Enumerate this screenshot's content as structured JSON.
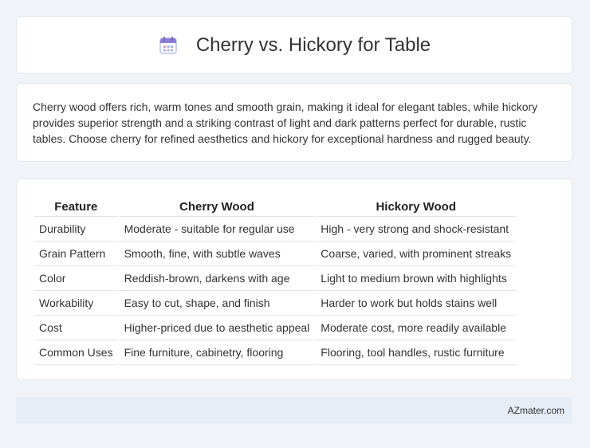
{
  "header": {
    "title": "Cherry vs. Hickory for Table",
    "icon": "calendar-icon"
  },
  "summary": {
    "text": "Cherry wood offers rich, warm tones and smooth grain, making it ideal for elegant tables, while hickory provides superior strength and a striking contrast of light and dark patterns perfect for durable, rustic tables. Choose cherry for refined aesthetics and hickory for exceptional hardness and rugged beauty."
  },
  "table": {
    "headers": [
      "Feature",
      "Cherry Wood",
      "Hickory Wood"
    ],
    "rows": [
      [
        "Durability",
        "Moderate - suitable for regular use",
        "High - very strong and shock-resistant"
      ],
      [
        "Grain Pattern",
        "Smooth, fine, with subtle waves",
        "Coarse, varied, with prominent streaks"
      ],
      [
        "Color",
        "Reddish-brown, darkens with age",
        "Light to medium brown with highlights"
      ],
      [
        "Workability",
        "Easy to cut, shape, and finish",
        "Harder to work but holds stains well"
      ],
      [
        "Cost",
        "Higher-priced due to aesthetic appeal",
        "Moderate cost, more readily available"
      ],
      [
        "Common Uses",
        "Fine furniture, cabinetry, flooring",
        "Flooring, tool handles, rustic furniture"
      ]
    ]
  },
  "footer": {
    "brand": "AZmater.com"
  },
  "colors": {
    "background": "#f0f3f8",
    "card": "#ffffff",
    "footer": "#e6edf7",
    "icon_accent": "#8a7fd6"
  }
}
